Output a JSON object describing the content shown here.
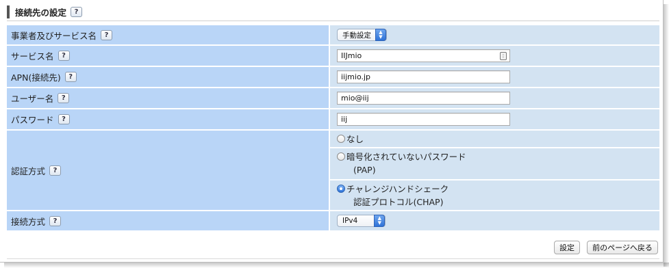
{
  "section": {
    "title": "接続先の設定",
    "help_label": "?"
  },
  "rows": {
    "operator": {
      "label": "事業者及びサービス名",
      "select_value": "手動設定"
    },
    "service": {
      "label": "サービス名",
      "value": "IIJmio"
    },
    "apn": {
      "label": "APN(接続先)",
      "value": "iijmio.jp"
    },
    "username": {
      "label": "ユーザー名",
      "value": "mio@iij"
    },
    "password": {
      "label": "パスワード",
      "value": "iij"
    },
    "auth": {
      "label": "認証方式",
      "options": [
        {
          "line1": "なし",
          "line2": "",
          "selected": false
        },
        {
          "line1": "暗号化されていないパスワード",
          "line2": "(PAP)",
          "selected": false
        },
        {
          "line1": "チャレンジハンドシェーク",
          "line2": "認証プロトコル(CHAP)",
          "selected": true
        }
      ]
    },
    "connection": {
      "label": "接続方式",
      "select_value": "IPv4"
    }
  },
  "buttons": {
    "apply": "設定",
    "back": "前のページへ戻る"
  },
  "colors": {
    "label_bg": "#b9d5f7",
    "value_bg": "#d3e3f2",
    "accent": "#2e74db"
  }
}
